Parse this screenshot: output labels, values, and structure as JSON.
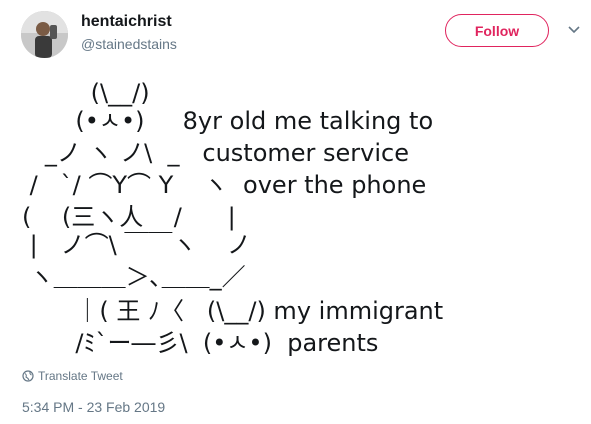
{
  "user": {
    "display_name": "hentaichrist",
    "handle": "@stainedstains"
  },
  "actions": {
    "follow_label": "Follow",
    "follow_color": "#e0245e"
  },
  "tweet": {
    "lines": [
      "         (\\__/)",
      "       (•ㅅ•)     8yr old me talking to",
      "   _ノ ヽ ノ\\  _   customer service",
      " /   `/ ⌒Y⌒ Y    ヽ  over the phone",
      "(    (三ヽ人    /      |",
      " |   ノ⌒\\ ￣￣ヽ    ノ",
      " ヽ＿＿＿＞､＿＿_／",
      "       ｜( 王 ﾉ〈   (\\__/) my immigrant",
      "       /ﾐ`ー―彡\\  (•ㅅ•)  parents"
    ]
  },
  "footer": {
    "translate_label": "Translate Tweet",
    "timestamp": "5:34 PM - 23 Feb 2019"
  },
  "icons": {
    "avatar": "profile-photo",
    "chevron": "chevron-down-icon",
    "globe": "globe-icon"
  }
}
